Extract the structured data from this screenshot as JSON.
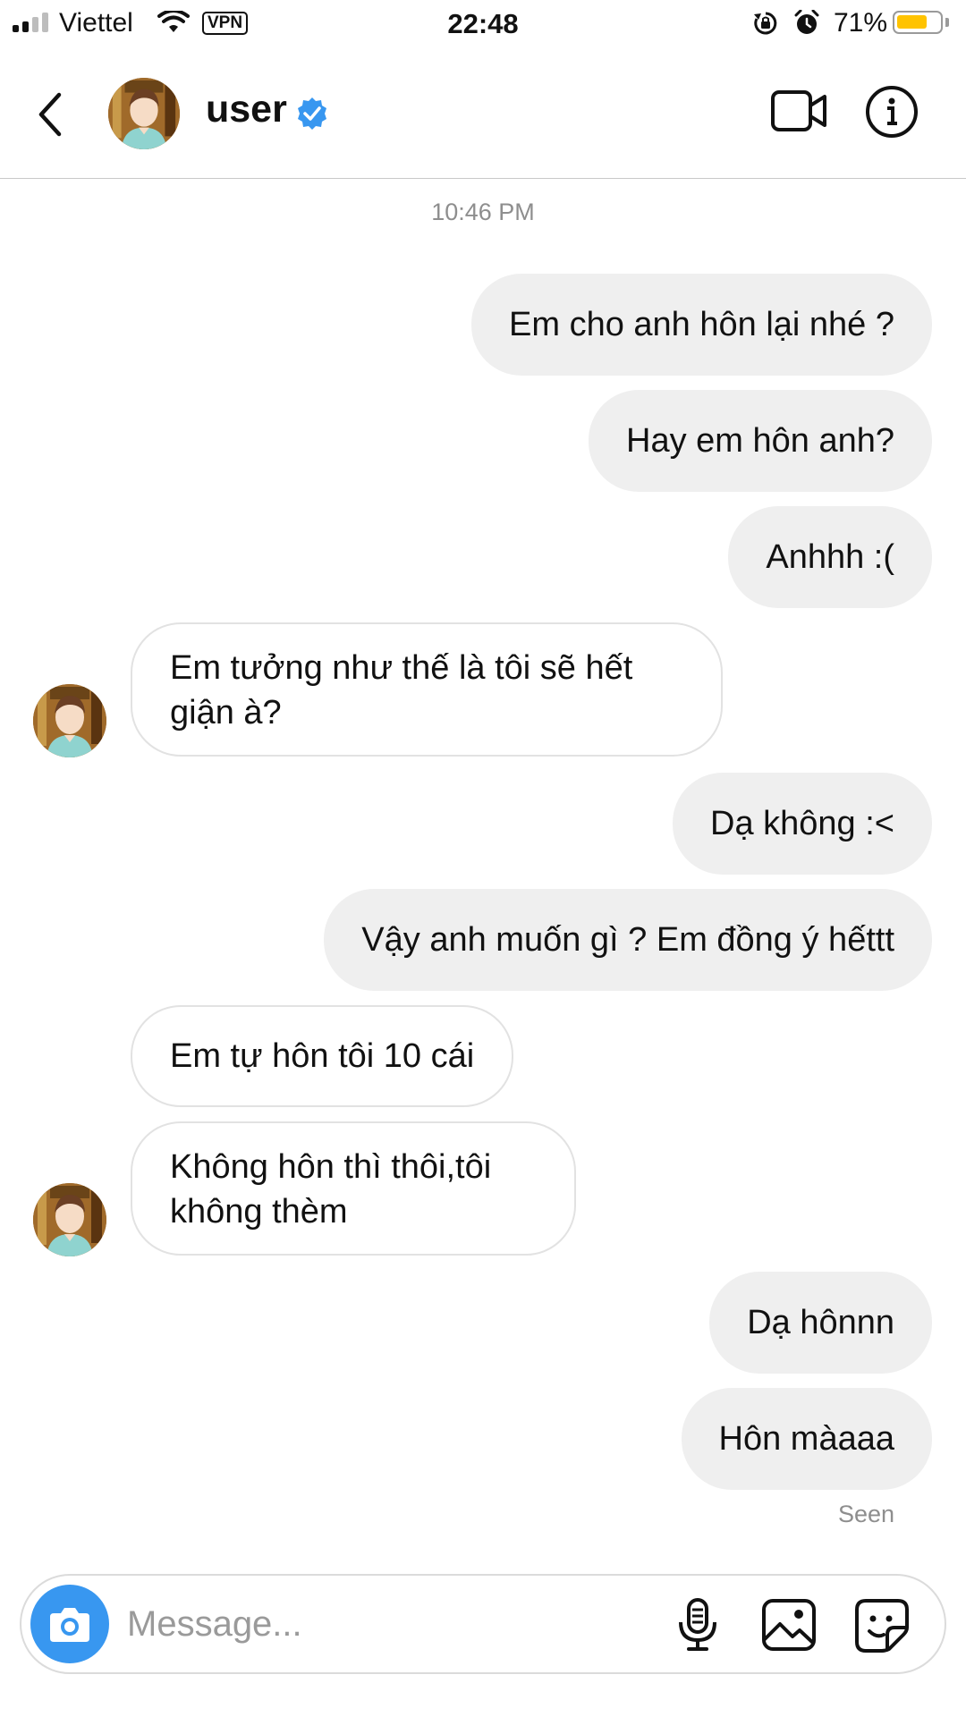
{
  "status_bar": {
    "carrier": "Viettel",
    "vpn": "VPN",
    "time": "22:48",
    "battery_percent": "71%",
    "battery_level": 0.71,
    "battery_color": "#ffc300"
  },
  "header": {
    "back_icon": "chevron-left-icon",
    "username": "user",
    "verified_icon": "verified-badge-icon",
    "verified_color": "#3897f0",
    "video_icon": "video-camera-icon",
    "info_icon": "info-icon"
  },
  "thread": {
    "timestamp": "10:46 PM",
    "messages": [
      {
        "from": "me",
        "text": "Em cho anh hôn lại nhé ?"
      },
      {
        "from": "me",
        "text": "Hay em hôn anh?"
      },
      {
        "from": "me",
        "text": "Anhhh :("
      },
      {
        "from": "them",
        "text": "Em tưởng như thế là tôi sẽ hết giận à?"
      },
      {
        "from": "me",
        "text": "Dạ không :<"
      },
      {
        "from": "me",
        "text": "Vậy anh muốn gì ? Em đồng ý hếttt"
      },
      {
        "from": "them",
        "text": "Em tự hôn tôi 10 cái"
      },
      {
        "from": "them",
        "text": "Không hôn thì thôi,tôi không thèm"
      },
      {
        "from": "me",
        "text": "Dạ hônnn"
      },
      {
        "from": "me",
        "text": "Hôn màaaa"
      }
    ],
    "seen_label": "Seen"
  },
  "composer": {
    "placeholder": "Message...",
    "camera_icon": "camera-icon",
    "camera_color": "#3897f0",
    "mic_icon": "microphone-icon",
    "gallery_icon": "image-gallery-icon",
    "sticker_icon": "sticker-icon"
  }
}
